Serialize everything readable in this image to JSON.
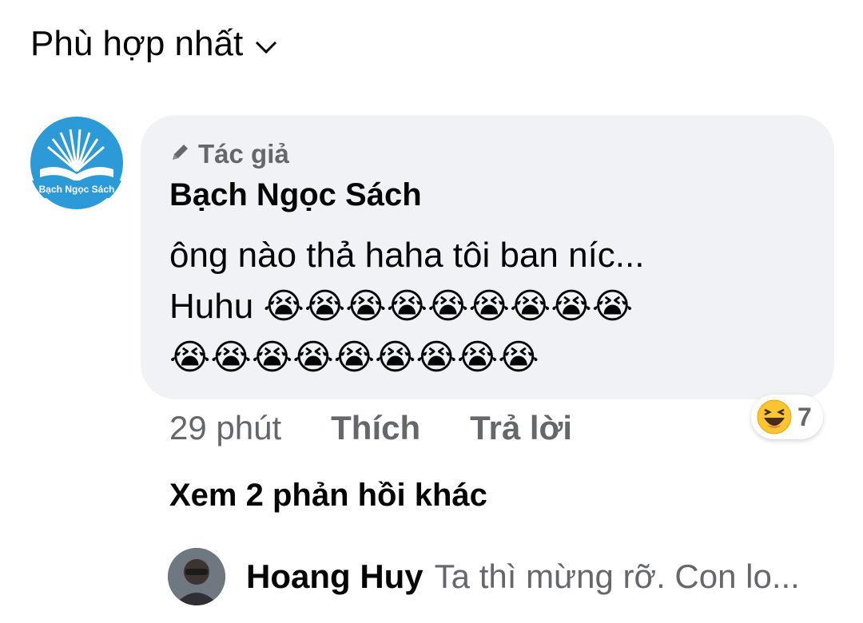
{
  "sort": {
    "label": "Phù hợp nhất",
    "icon": "chevron-down-icon"
  },
  "comment": {
    "avatar_label": "Bạch Ngọc Sách",
    "badge_label": "Tác giả",
    "badge_icon": "pen-icon",
    "author": "Bạch Ngọc Sách",
    "text": "ông nào thả haha tôi ban níc...\nHuhu 😭😭😭😭😭😭😭😭😭\n😭😭😭😭😭😭😭😭😭",
    "time": "29 phút",
    "like_label": "Thích",
    "reply_label": "Trả lời",
    "reaction_icon": "haha-reaction-icon",
    "reaction_count": "7"
  },
  "replies": {
    "more_label": "Xem 2 phản hồi khác",
    "preview_name": "Hoang Huy",
    "preview_text": "Ta thì mừng rỡ. Con lo..."
  },
  "colors": {
    "bubble": "#f0f2f5",
    "secondary_text": "#65676b",
    "primary_text": "#050505",
    "avatar_blue": "#2c9ad6"
  }
}
